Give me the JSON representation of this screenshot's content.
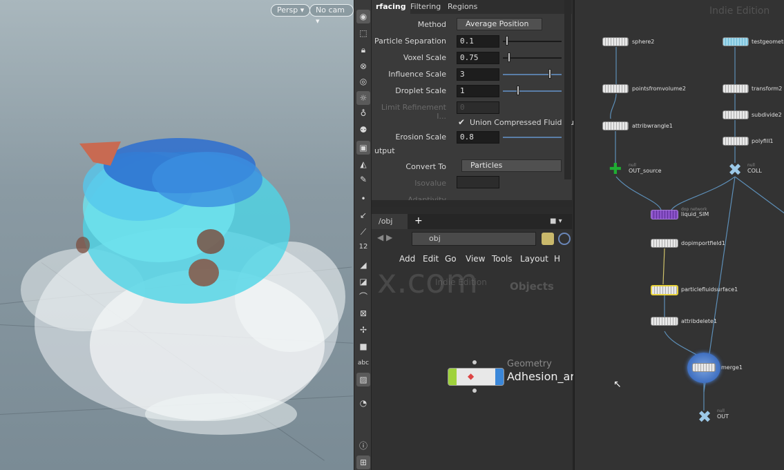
{
  "viewport": {
    "persp_label": "Persp ▾",
    "cam_label": "No cam ▾"
  },
  "shelf": {
    "icons": [
      "eye-icon",
      "select-icon",
      "lock-icon",
      "handle-icon",
      "snap-icon",
      "light-icon",
      "bulb-icon",
      "camera-icon",
      "scene-icon",
      "shape-icon",
      "brush-icon",
      "point-icon",
      "arrow-icon",
      "pen-icon",
      "number-icon",
      "paint-icon",
      "edit-icon",
      "curve-icon",
      "measure-icon",
      "box-icon",
      "text-icon",
      "image-icon",
      "light2-icon",
      "info-icon",
      "grid-icon"
    ],
    "number_label": "12",
    "abc_label": "abc"
  },
  "params": {
    "tabs": [
      "rfacing",
      "Filtering",
      "Regions"
    ],
    "method_label": "Method",
    "method_value": "Average Position",
    "particle_separation_label": "Particle Separation",
    "particle_separation_value": "0.1",
    "voxel_scale_label": "Voxel Scale",
    "voxel_scale_value": "0.75",
    "influence_scale_label": "Influence Scale",
    "influence_scale_value": "3",
    "droplet_scale_label": "Droplet Scale",
    "droplet_scale_value": "1",
    "limit_refinement_label": "Limit Refinement I...",
    "limit_refinement_value": "0",
    "union_label": "Union Compressed Fluid Sur",
    "erosion_scale_label": "Erosion Scale",
    "erosion_scale_value": "0.8",
    "output_section": "utput",
    "convert_to_label": "Convert To",
    "convert_to_value": "Particles",
    "isovalue_label": "Isovalue",
    "adaptivity_label": "Adaptivity"
  },
  "network": {
    "tab_label": "/obj",
    "path_value": "obj",
    "menu": [
      "Add",
      "Edit",
      "Go",
      "View",
      "Tools",
      "Layout",
      "H"
    ],
    "watermark": "x.com",
    "edition_text": "Indie Edition",
    "context_text": "Objects",
    "node_type": "Geometry",
    "node_name": "Adhesion_ar"
  },
  "graph": {
    "edition_text": "Indie Edition",
    "nodes": [
      {
        "name": "sphere2"
      },
      {
        "name": "pointsfromvolume2"
      },
      {
        "name": "attribwrangle1"
      },
      {
        "name": "OUT_source",
        "sub": "null"
      },
      {
        "name": "testgeometry"
      },
      {
        "name": "transform2"
      },
      {
        "name": "subdivide2"
      },
      {
        "name": "polyfill1"
      },
      {
        "name": "COLL",
        "sub": "null"
      },
      {
        "name": "liquid_SIM",
        "sub": "dop network"
      },
      {
        "name": "dopimportfield1"
      },
      {
        "name": "particlefluidsurface1"
      },
      {
        "name": "attribdelete1"
      },
      {
        "name": "merge1"
      },
      {
        "name": "OUT",
        "sub": "null"
      }
    ]
  },
  "colors": {
    "accent_blue": "#4aa3df",
    "selected_yellow": "#e8d23a",
    "sim_purple": "#7d3fb5",
    "out_green": "#1fae33"
  }
}
